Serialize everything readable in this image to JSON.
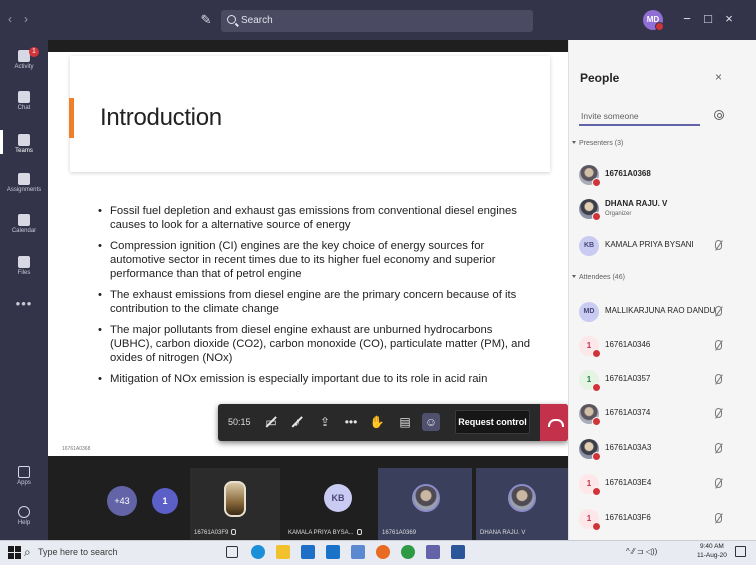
{
  "titlebar": {
    "back_glyph": "‹",
    "forward_glyph": "›",
    "search_placeholder": "Search",
    "user_initials": "MD",
    "min_glyph": "−",
    "max_glyph": "□",
    "close_glyph": "×"
  },
  "rail": {
    "items": [
      {
        "label": "Activity",
        "icon": "bell-icon",
        "badge": "1"
      },
      {
        "label": "Chat",
        "icon": "chat-icon"
      },
      {
        "label": "Teams",
        "icon": "teams-icon"
      },
      {
        "label": "Assignments",
        "icon": "assignments-icon"
      },
      {
        "label": "Calendar",
        "icon": "calendar-icon"
      },
      {
        "label": "Files",
        "icon": "files-icon"
      }
    ],
    "more": "•••",
    "apps": "Apps",
    "help": "Help"
  },
  "slide": {
    "title": "Introduction",
    "bullets": [
      "Fossil fuel depletion and exhaust gas emissions from conventional diesel engines causes to look for a alternative source of energy",
      "Compression ignition (CI) engines are the key choice of energy sources for automotive sector in recent times due to its higher fuel economy and superior performance than that of petrol engine",
      "The exhaust emissions from diesel engine are the primary concern because of its contribution to the climate change",
      "The major pollutants from diesel engine exhaust are unburned hydrocarbons (UBHC), carbon dioxide (CO2), carbon monoxide (CO), particulate matter (PM), and oxides of nitrogen (NOx)",
      "Mitigation of NOx emission is especially important due to its role in acid rain"
    ],
    "footer": "16761A0368"
  },
  "controls": {
    "timer": "50:15",
    "more_glyph": "•••",
    "request_control": "Request control"
  },
  "strip": {
    "overflow": "+43",
    "count": "1",
    "tiles": [
      {
        "name": "16761A03F9"
      },
      {
        "initials": "KB",
        "name": "KAMALA PRIYA BYSA..."
      },
      {
        "name": "16761A0369"
      },
      {
        "name": "DHANA RAJU. V"
      }
    ]
  },
  "people": {
    "title": "People",
    "close_glyph": "×",
    "invite_placeholder": "Invite someone",
    "presenters_label": "Presenters (3)",
    "attendees_label": "Attendees (46)",
    "presenters": [
      {
        "name": "16761A0368",
        "avatar": "photo"
      },
      {
        "name": "DHANA RAJU. V",
        "role": "Organizer",
        "avatar": "photo"
      },
      {
        "name": "KAMALA PRIYA BYSANI",
        "initials": "KB"
      }
    ],
    "attendees": [
      {
        "name": "MALLIKARJUNA RAO DANDU",
        "initials": "MD"
      },
      {
        "name": "16761A0346",
        "initials": "1"
      },
      {
        "name": "16761A0357",
        "initials": "1"
      },
      {
        "name": "16761A0374",
        "avatar": "photo"
      },
      {
        "name": "16761A03A3",
        "avatar": "photo"
      },
      {
        "name": "16761A03E4",
        "initials": "1"
      },
      {
        "name": "16761A03F6",
        "initials": "1"
      }
    ]
  },
  "taskbar": {
    "search_placeholder": "Type here to search",
    "tray": "^ ⁄⁄ ⊐ ◁))",
    "time": "9:40 AM",
    "date": "11-Aug-20"
  },
  "colors": {
    "teams_dark": "#33344a",
    "brand": "#6264a7",
    "slide_accent": "#f07f2a",
    "hangup": "#c4314b",
    "presence_busy": "#d13438"
  }
}
